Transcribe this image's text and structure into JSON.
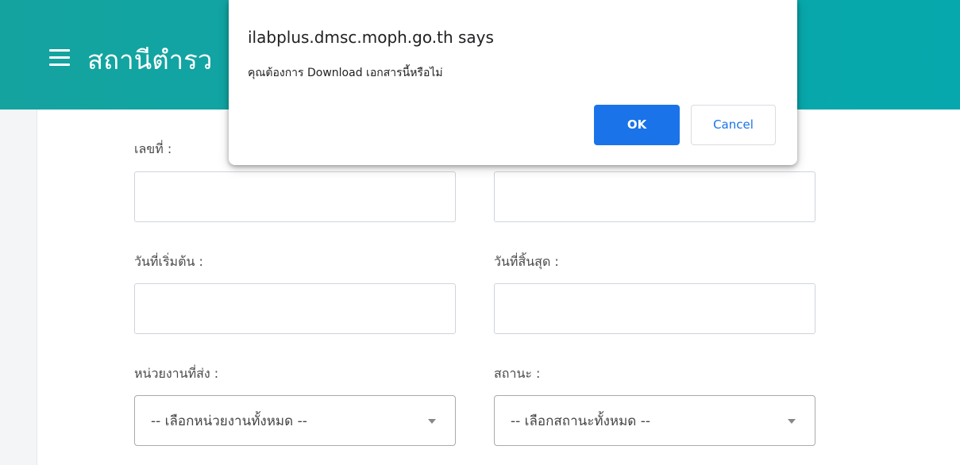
{
  "header": {
    "title": "สถานีตำรว",
    "menu_icon": "hamburger-menu-icon",
    "background": "#0aa6a8"
  },
  "form": {
    "number_label": "เลขที่ :",
    "number_value": "",
    "right_top_value": "",
    "start_date_label": "วันที่เริ่มต้น :",
    "start_date_value": "",
    "end_date_label": "วันที่สิ้นสุด :",
    "end_date_value": "",
    "agency_label": "หน่วยงานที่ส่ง :",
    "agency_selected": "-- เลือกหน่วยงานทั้งหมด --",
    "status_label": "สถานะ :",
    "status_selected": "-- เลือกสถานะทั้งหมด --"
  },
  "dialog": {
    "origin": "ilabplus.dmsc.moph.go.th says",
    "message": "คุณต้องการ Download เอกสารนี้หรือไม่",
    "ok_label": "OK",
    "cancel_label": "Cancel",
    "accent": "#1a73e8"
  }
}
